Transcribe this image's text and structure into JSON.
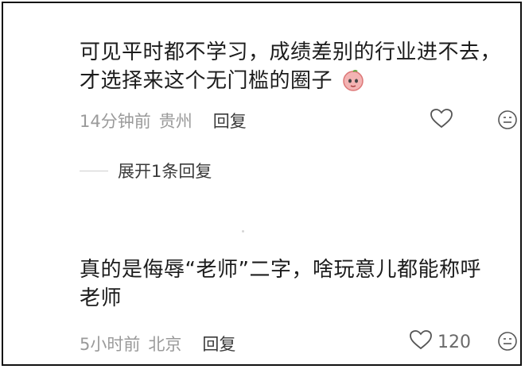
{
  "comments": [
    {
      "line1": "可见平时都不学习，成绩差别的行业进不去，",
      "line2": "才选择来这个无门槛的圈子",
      "time": "14分钟前",
      "location": "贵州",
      "reply_label": "回复",
      "like_count": ""
    },
    {
      "line1": "真的是侮辱“老师”二字，啥玩意儿都能称呼",
      "line2": "老师",
      "time": "5小时前",
      "location": "北京",
      "reply_label": "回复",
      "like_count": "120"
    }
  ],
  "expand_replies": "展开1条回复",
  "icons": {
    "like": "heart-outline-icon",
    "sticker": "emoji-face-icon",
    "inline": "peach-emoji-icon"
  }
}
